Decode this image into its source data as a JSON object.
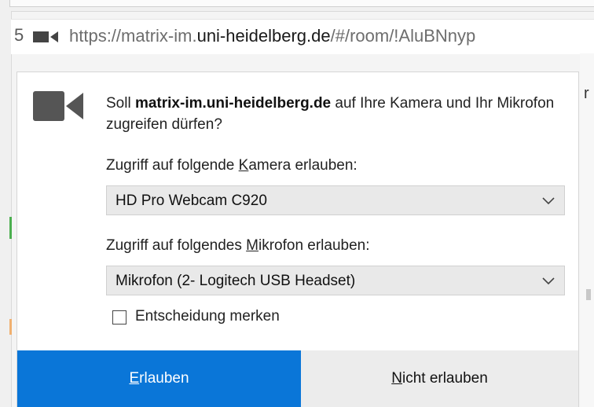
{
  "urlbar": {
    "prefix_glyph": "5",
    "url_scheme": "https://matrix-im.",
    "url_host": "uni-heidelberg.de",
    "url_rest": "/#/room/!AluBNnyp"
  },
  "prompt": {
    "intro": "Soll ",
    "site": "matrix-im.uni-heidelberg.de",
    "outro": " auf Ihre Kamera und Ihr Mikrofon zugreifen dürfen?"
  },
  "camera": {
    "label_before": "Zugriff auf folgende ",
    "label_key": "K",
    "label_after": "amera erlauben:",
    "selected": "HD Pro Webcam C920"
  },
  "microphone": {
    "label_before": "Zugriff auf folgendes ",
    "label_key": "M",
    "label_after": "ikrofon erlauben:",
    "selected": "Mikrofon (2- Logitech USB Headset)"
  },
  "remember": {
    "label": "Entscheidung merken",
    "checked": false
  },
  "buttons": {
    "allow_key": "E",
    "allow_rest": "rlauben",
    "deny_key": "N",
    "deny_rest": "icht erlauben"
  },
  "background": {
    "right_char": "r"
  },
  "colors": {
    "allow_button": "#0a76d8",
    "deny_button": "#ececec",
    "select_bg": "#e9e9e9",
    "icon_gray": "#555555"
  },
  "icons": {
    "urlbar_camera": "camera-icon",
    "prompt_camera": "camera-icon",
    "dropdown": "chevron-down-icon"
  }
}
